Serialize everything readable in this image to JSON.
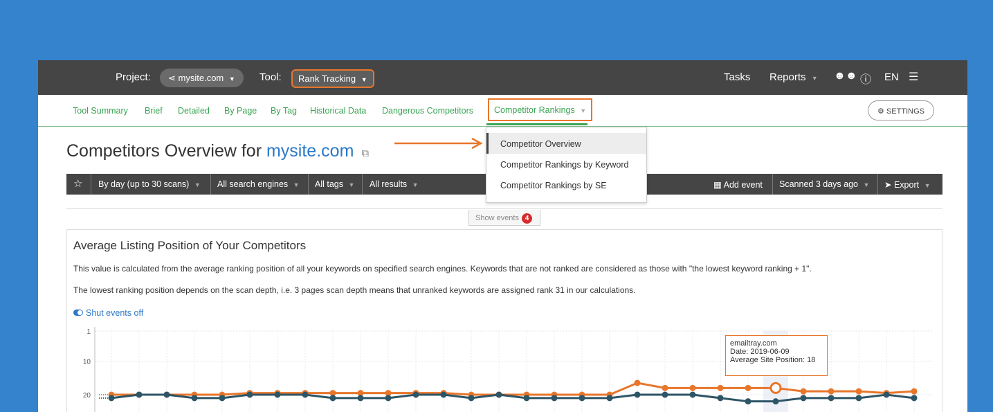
{
  "topbar": {
    "project_label": "Project:",
    "project_value": "mysite.com",
    "tool_label": "Tool:",
    "tool_value": "Rank Tracking",
    "tasks": "Tasks",
    "reports": "Reports",
    "lang": "EN",
    "icons": [
      "users-icon",
      "help-icon",
      "menu-icon"
    ]
  },
  "tabs": {
    "items": [
      "Tool Summary",
      "Brief",
      "Detailed",
      "By Page",
      "By Tag",
      "Historical Data",
      "Dangerous Competitors"
    ],
    "active": "Competitor Rankings",
    "settings": "SETTINGS"
  },
  "dropdown": {
    "items": [
      "Competitor Overview",
      "Competitor Rankings by Keyword",
      "Competitor Rankings by SE"
    ],
    "selected": "Competitor Overview"
  },
  "page": {
    "title_prefix": "Competitors Overview for",
    "title_link": "mysite.com"
  },
  "toolbar": {
    "period": "By day (up to 30 scans)",
    "engines": "All search engines",
    "tags": "All tags",
    "results": "All results",
    "add_event": "Add event",
    "scanned": "Scanned 3 days ago",
    "export": "Export"
  },
  "events": {
    "label": "Show events",
    "count": "4"
  },
  "panel": {
    "title": "Average Listing Position of Your Competitors",
    "text1": "This value is calculated from the average ranking position of all your keywords on specified search engines. Keywords that are not ranked are considered as those with \"the lowest keyword ranking + 1\".",
    "text2": "The lowest ranking position depends on the scan depth, i.e. 3 pages scan depth means that unranked keywords are assigned rank 31 in our calculations.",
    "shut_events": "Shut events off"
  },
  "tooltip": {
    "site": "emailtray.com",
    "date": "Date: 2019-06-09",
    "position": "Average Site Position: 18"
  },
  "chart_data": {
    "type": "line",
    "y_ticks": [
      "1",
      "10",
      "20"
    ],
    "y_reversed": true,
    "ylim": [
      1,
      22
    ],
    "grid": true,
    "colors": {
      "orange": "#e8762b",
      "teal": "#2e5566"
    },
    "series": [
      {
        "color": "#e8762b",
        "values": [
          20,
          20,
          20,
          20,
          20,
          19.5,
          19.5,
          19.5,
          19.5,
          19.5,
          19.5,
          19.5,
          19.5,
          20,
          20,
          20,
          20,
          20,
          20,
          16.5,
          18,
          18,
          18,
          18,
          18,
          19,
          19,
          19,
          19.5,
          19
        ]
      },
      {
        "color": "#2e5566",
        "values": [
          21,
          20,
          20,
          21,
          21,
          20,
          20,
          20,
          21,
          21,
          21,
          20,
          20,
          21,
          20,
          21,
          21,
          21,
          21,
          20,
          20,
          20,
          21,
          22,
          22,
          21,
          21,
          21,
          20,
          21
        ]
      }
    ]
  }
}
